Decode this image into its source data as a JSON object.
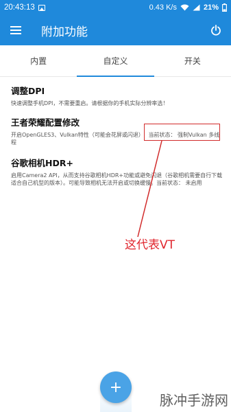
{
  "status_bar": {
    "time": "20:43:13",
    "speed": "0.43 K/s",
    "battery": "21%"
  },
  "app_bar": {
    "title": "附加功能"
  },
  "tabs": [
    {
      "label": "内置",
      "active": false
    },
    {
      "label": "自定义",
      "active": true
    },
    {
      "label": "开关",
      "active": false
    }
  ],
  "settings": [
    {
      "title": "调整DPI",
      "desc": "快速调整手机DPI，不需要重启。请根据你的手机实际分辨率选！"
    },
    {
      "title": "王者荣耀配置修改",
      "desc_line1": "开启OpenGLES3、Vulkan特性（可能会花屏或闪退）",
      "current_state": "当前状态：  强制Vulkan 多线",
      "desc_line2": "程"
    },
    {
      "title": "谷歌相机HDR+",
      "desc_line1": "启用Camera2 API，从而支持谷歌相机HDR+功能或避免闪退（谷歌相机需要自行下载",
      "desc_line2": "适合自己机型的版本）。可能导致相机无法开启或切换缓慢。当前状态：  未启用"
    }
  ],
  "annotation": {
    "text": "这代表VT",
    "color": "#e0242c"
  },
  "fab": {
    "label": "+"
  },
  "watermark": "脉冲手游网",
  "colors": {
    "primary": "#1f89db",
    "highlight_border": "#d12a2a"
  }
}
